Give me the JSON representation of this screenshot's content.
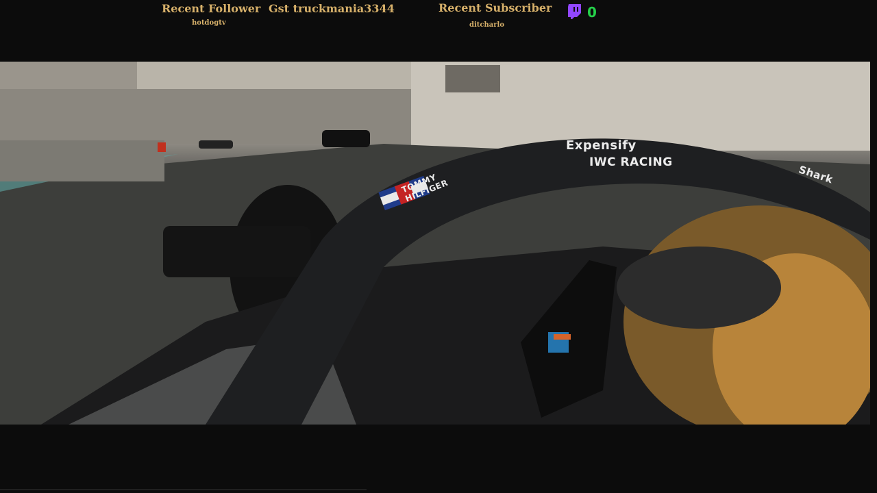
{
  "overlay": {
    "recent_follower_label": "Recent Follower",
    "recent_follower_name": "hotdogtv",
    "recent_gifter": "Gst truckmania3344",
    "recent_subscriber_label": "Recent Subscriber",
    "recent_subscriber_name": "ditcharlo",
    "twitch_count": "0",
    "twitch_icon": "twitch-icon",
    "accent_color": "#d6b06a",
    "count_color": "#25d14a"
  },
  "video": {
    "halo_sponsor_top": "Expensify",
    "halo_sponsor_bottom": "IWC RACING",
    "halo_side_text": "TOMMY HILFIGER",
    "halo_right_text": "Shark"
  }
}
